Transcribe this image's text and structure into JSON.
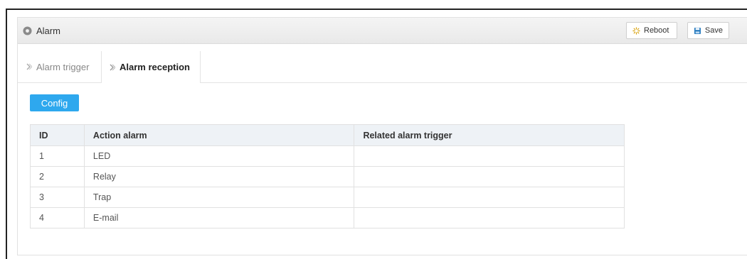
{
  "header": {
    "title": "Alarm",
    "reboot_label": "Reboot",
    "save_label": "Save"
  },
  "tabs": [
    {
      "label": "Alarm trigger",
      "active": false
    },
    {
      "label": "Alarm reception",
      "active": true
    }
  ],
  "config_label": "Config",
  "table": {
    "columns": [
      "ID",
      "Action alarm",
      "Related alarm trigger"
    ],
    "rows": [
      {
        "id": "1",
        "action": "LED",
        "related": ""
      },
      {
        "id": "2",
        "action": "Relay",
        "related": ""
      },
      {
        "id": "3",
        "action": "Trap",
        "related": ""
      },
      {
        "id": "4",
        "action": "E-mail",
        "related": ""
      }
    ]
  },
  "colors": {
    "accent": "#2ea8ee",
    "header_bg": "#eef2f6"
  },
  "icons": {
    "header": "gear-icon",
    "reboot": "reboot-icon",
    "save": "save-icon",
    "tab": "chevron-right-icon"
  }
}
